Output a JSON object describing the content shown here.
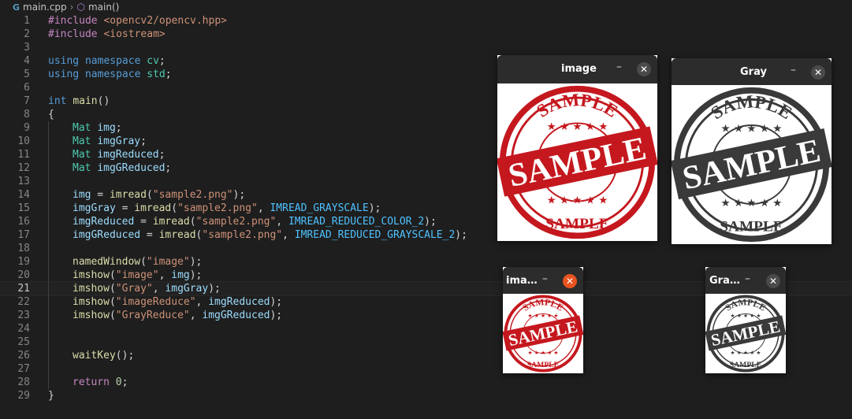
{
  "breadcrumb": {
    "file": "main.cpp",
    "separator": "›",
    "symbol": "main()"
  },
  "code_lines": [
    {
      "n": "1"
    },
    {
      "n": "2"
    },
    {
      "n": "3"
    },
    {
      "n": "4"
    },
    {
      "n": "5"
    },
    {
      "n": "6"
    },
    {
      "n": "7"
    },
    {
      "n": "8"
    },
    {
      "n": "9"
    },
    {
      "n": "10"
    },
    {
      "n": "11"
    },
    {
      "n": "12"
    },
    {
      "n": "13"
    },
    {
      "n": "14"
    },
    {
      "n": "15"
    },
    {
      "n": "16"
    },
    {
      "n": "17"
    },
    {
      "n": "18"
    },
    {
      "n": "19"
    },
    {
      "n": "20"
    },
    {
      "n": "21"
    },
    {
      "n": "22"
    },
    {
      "n": "23"
    },
    {
      "n": "24"
    },
    {
      "n": "25"
    },
    {
      "n": "26"
    },
    {
      "n": "27"
    },
    {
      "n": "28"
    },
    {
      "n": "29"
    }
  ],
  "code": {
    "l1a": "#include",
    "l1b": "<opencv2/opencv.hpp>",
    "l2a": "#include",
    "l2b": "<iostream>",
    "l4a": "using",
    "l4b": "namespace",
    "l4c": "cv",
    "l4d": ";",
    "l5a": "using",
    "l5b": "namespace",
    "l5c": "std",
    "l5d": ";",
    "l7a": "int",
    "l7b": "main",
    "l7c": "()",
    "l8": "{",
    "l9a": "Mat",
    "l9b": "img",
    "l9c": ";",
    "l10a": "Mat",
    "l10b": "imgGray",
    "l10c": ";",
    "l11a": "Mat",
    "l11b": "imgReduced",
    "l11c": ";",
    "l12a": "Mat",
    "l12b": "imgGReduced",
    "l12c": ";",
    "l14a": "img",
    "l14b": " = ",
    "l14c": "imread",
    "l14d": "(",
    "l14e": "\"sample2.png\"",
    "l14f": ");",
    "l15a": "imgGray",
    "l15b": " = ",
    "l15c": "imread",
    "l15d": "(",
    "l15e": "\"sample2.png\"",
    "l15f": ", ",
    "l15g": "IMREAD_GRAYSCALE",
    "l15h": ");",
    "l16a": "imgReduced",
    "l16b": " = ",
    "l16c": "imread",
    "l16d": "(",
    "l16e": "\"sample2.png\"",
    "l16f": ", ",
    "l16g": "IMREAD_REDUCED_COLOR_2",
    "l16h": ");",
    "l17a": "imgGReduced",
    "l17b": " = ",
    "l17c": "imread",
    "l17d": "(",
    "l17e": "\"sample2.png\"",
    "l17f": ", ",
    "l17g": "IMREAD_REDUCED_GRAYSCALE_2",
    "l17h": ");",
    "l19a": "namedWindow",
    "l19b": "(",
    "l19c": "\"image\"",
    "l19d": ");",
    "l20a": "imshow",
    "l20b": "(",
    "l20c": "\"image\"",
    "l20d": ", ",
    "l20e": "img",
    "l20f": ");",
    "l21a": "imshow",
    "l21b": "(",
    "l21c": "\"Gray\"",
    "l21d": ", ",
    "l21e": "imgGray",
    "l21f": ");",
    "l22a": "imshow",
    "l22b": "(",
    "l22c": "\"imageReduce\"",
    "l22d": ", ",
    "l22e": "imgReduced",
    "l22f": ");",
    "l23a": "imshow",
    "l23b": "(",
    "l23c": "\"GrayReduce\"",
    "l23d": ", ",
    "l23e": "imgGReduced",
    "l23f": ");",
    "l26a": "waitKey",
    "l26b": "();",
    "l28a": "return",
    "l28b": " ",
    "l28c": "0",
    "l28d": ";",
    "l29": "}"
  },
  "windows": {
    "image": {
      "title": "image",
      "minimize": "–",
      "close": "✕"
    },
    "gray": {
      "title": "Gray",
      "minimize": "–",
      "close": "✕"
    },
    "image_reduce": {
      "title": "ima…",
      "minimize": "–",
      "close": "✕"
    },
    "gray_reduce": {
      "title": "Gra…",
      "minimize": "–",
      "close": "✕"
    }
  },
  "stamp": {
    "top_word": "SAMPLE",
    "center_word": "SAMPLE",
    "bottom_word": "SAMPLE"
  },
  "colors": {
    "stamp_red": "#c4181e",
    "stamp_gray": "#3a3a3a",
    "titlebar": "#2c2c2c",
    "close_active": "#e95420"
  }
}
